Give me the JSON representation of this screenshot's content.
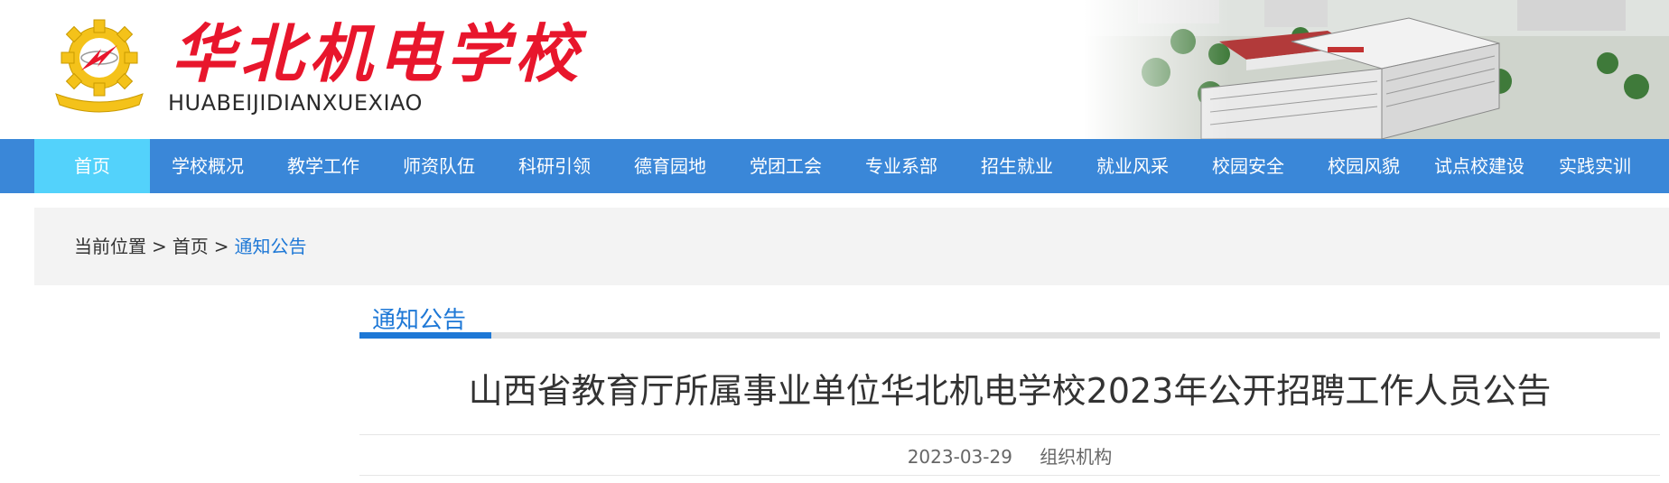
{
  "header": {
    "logo_cn": "华北机电学校",
    "logo_en": "HUABEIJIDIANXUEXIAO",
    "emblem_icon": "gear-lightning-emblem-icon",
    "banner_image": "campus-aerial-image"
  },
  "nav": {
    "items": [
      {
        "label": "首页",
        "active": true
      },
      {
        "label": "学校概况"
      },
      {
        "label": "教学工作"
      },
      {
        "label": "师资队伍"
      },
      {
        "label": "科研引领"
      },
      {
        "label": "德育园地"
      },
      {
        "label": "党团工会"
      },
      {
        "label": "专业系部"
      },
      {
        "label": "招生就业"
      },
      {
        "label": "就业风采"
      },
      {
        "label": "校园安全"
      },
      {
        "label": "校园风貌"
      },
      {
        "label": "试点校建设"
      },
      {
        "label": "实践实训"
      }
    ]
  },
  "breadcrumb": {
    "prefix": "当前位置",
    "separator": ">",
    "home": "首页",
    "current": "通知公告"
  },
  "section": {
    "tab_label": "通知公告"
  },
  "article": {
    "title": "山西省教育厅所属事业单位华北机电学校2023年公开招聘工作人员公告",
    "date": "2023-03-29",
    "author": "组织机构"
  },
  "colors": {
    "nav_bg": "#3a87d8",
    "nav_active": "#53d2fb",
    "accent": "#1e78d6",
    "logo_red": "#e8162c"
  }
}
